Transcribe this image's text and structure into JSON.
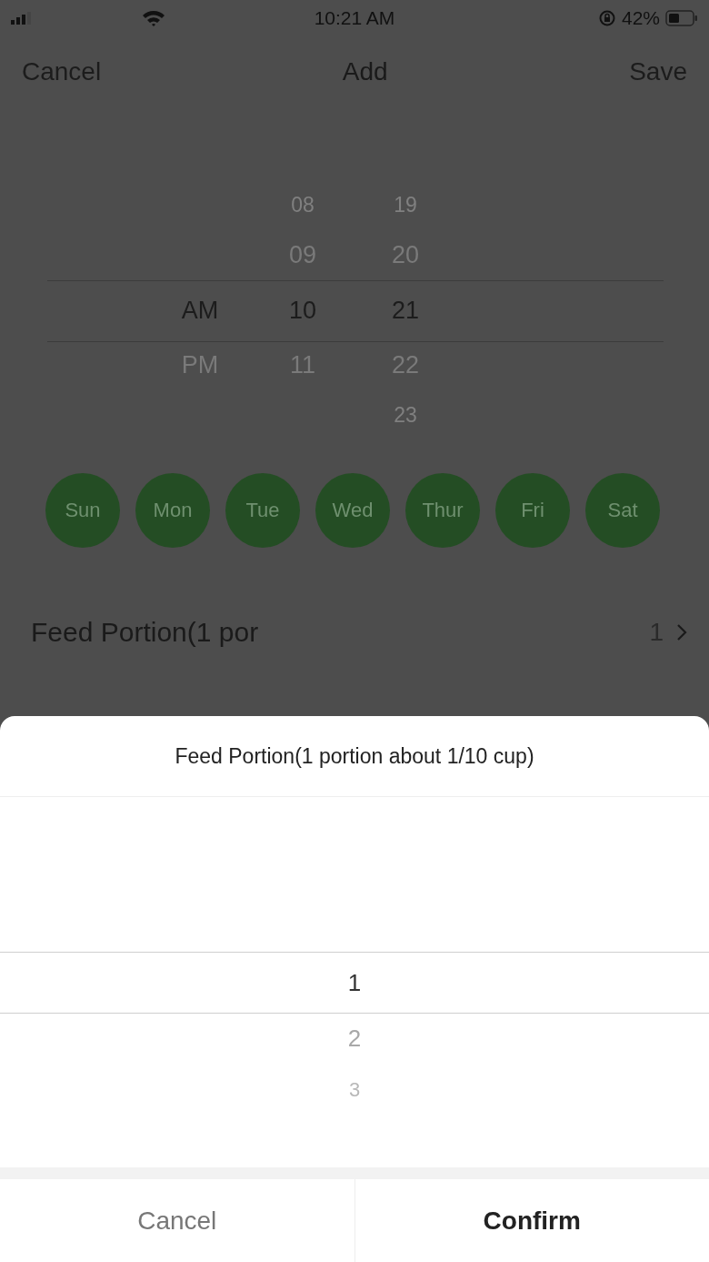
{
  "status_bar": {
    "time": "10:21 AM",
    "battery": "42%"
  },
  "nav": {
    "cancel": "Cancel",
    "title": "Add",
    "save": "Save"
  },
  "time_picker": {
    "columns": [
      {
        "items": [
          {
            "label": "AM",
            "selected": true
          },
          {
            "label": "PM",
            "selected": false
          }
        ]
      },
      {
        "items": [
          {
            "label": "08",
            "selected": false
          },
          {
            "label": "09",
            "selected": false
          },
          {
            "label": "10",
            "selected": true
          },
          {
            "label": "11",
            "selected": false
          }
        ]
      },
      {
        "items": [
          {
            "label": "19",
            "selected": false
          },
          {
            "label": "20",
            "selected": false
          },
          {
            "label": "21",
            "selected": true
          },
          {
            "label": "22",
            "selected": false
          },
          {
            "label": "23",
            "selected": false
          }
        ]
      }
    ]
  },
  "days": [
    {
      "label": "Sun",
      "selected": true
    },
    {
      "label": "Mon",
      "selected": true
    },
    {
      "label": "Tue",
      "selected": true
    },
    {
      "label": "Wed",
      "selected": true
    },
    {
      "label": "Thur",
      "selected": true
    },
    {
      "label": "Fri",
      "selected": true
    },
    {
      "label": "Sat",
      "selected": true
    }
  ],
  "feed_row": {
    "label": "Feed Portion(1 por",
    "value": "1"
  },
  "sheet": {
    "title": "Feed Portion(1 portion about 1/10 cup)",
    "options": [
      {
        "label": "1",
        "selected": true
      },
      {
        "label": "2",
        "selected": false
      },
      {
        "label": "3",
        "selected": false
      }
    ],
    "buttons": [
      {
        "label": "Cancel",
        "kind": "cancel"
      },
      {
        "label": "Confirm",
        "kind": "confirm"
      }
    ]
  }
}
